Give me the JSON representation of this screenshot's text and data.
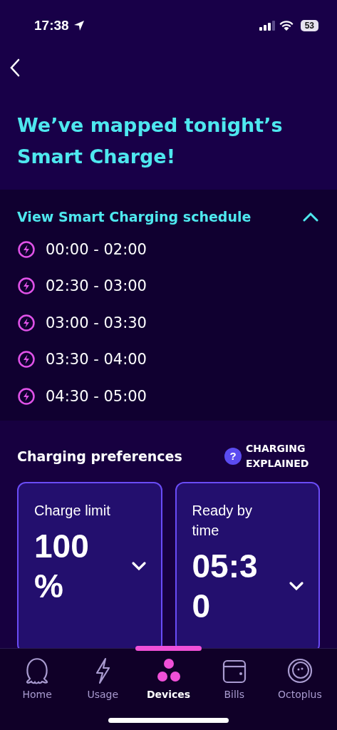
{
  "status_bar": {
    "time": "17:38",
    "battery": "53"
  },
  "title": "We’ve mapped tonight’s Smart Charge!",
  "schedule": {
    "heading": "View Smart Charging schedule",
    "expanded": true,
    "slots": [
      {
        "time": "00:00 - 02:00"
      },
      {
        "time": "02:30 - 03:00"
      },
      {
        "time": "03:00 - 03:30"
      },
      {
        "time": "03:30 - 04:00"
      },
      {
        "time": "04:30 - 05:00"
      }
    ]
  },
  "preferences": {
    "heading": "Charging preferences",
    "help_icon": "?",
    "help_link": "CHARGING EXPLAINED",
    "cards": [
      {
        "label": "Charge limit",
        "value": "100 %"
      },
      {
        "label": "Ready by time",
        "value": "05:30"
      }
    ]
  },
  "tabs": [
    {
      "kind": "home",
      "label": "Home",
      "selected": false
    },
    {
      "kind": "usage",
      "label": "Usage",
      "selected": false
    },
    {
      "kind": "devices",
      "label": "Devices",
      "selected": true
    },
    {
      "kind": "bills",
      "label": "Bills",
      "selected": false
    },
    {
      "kind": "octoplus",
      "label": "Octoplus",
      "selected": false
    }
  ]
}
